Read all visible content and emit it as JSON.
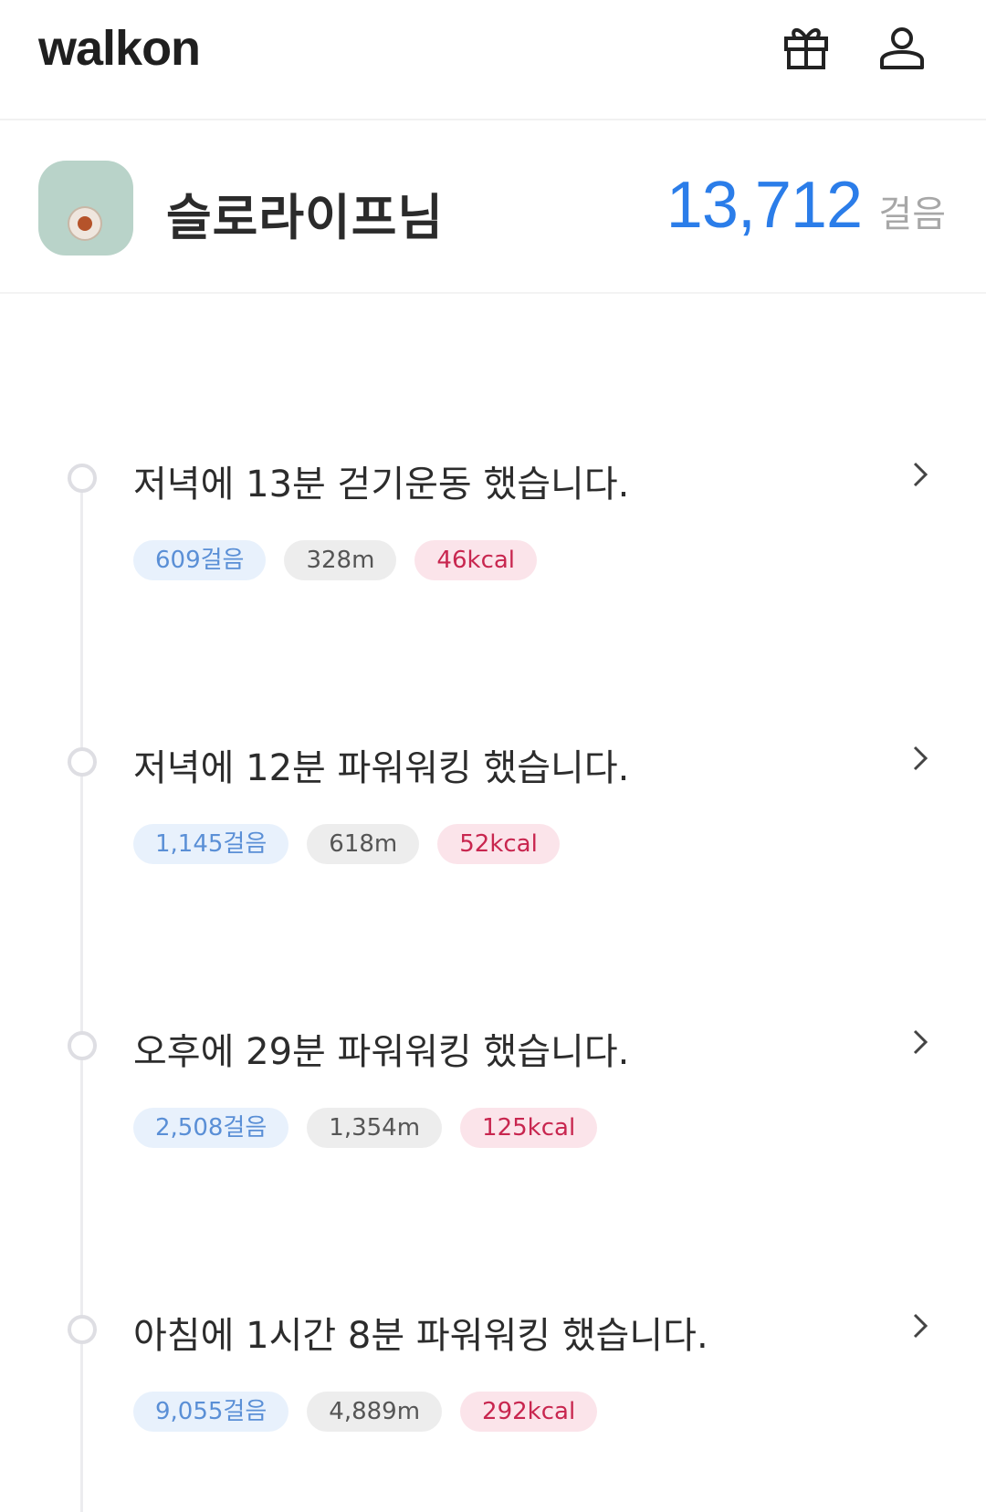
{
  "header": {
    "logo": "walkon",
    "icons": [
      "gift-icon",
      "person-icon"
    ]
  },
  "profile": {
    "name": "슬로라이프님",
    "steps": "13,712",
    "steps_unit": "걸음"
  },
  "entries": [
    {
      "title": "저녁에 13분 걷기운동 했습니다.",
      "steps": "609걸음",
      "distance": "328m",
      "kcal": "46kcal"
    },
    {
      "title": "저녁에 12분 파워워킹 했습니다.",
      "steps": "1,145걸음",
      "distance": "618m",
      "kcal": "52kcal"
    },
    {
      "title": "오후에 29분 파워워킹 했습니다.",
      "steps": "2,508걸음",
      "distance": "1,354m",
      "kcal": "125kcal"
    },
    {
      "title": "아침에 1시간 8분 파워워킹 했습니다.",
      "steps": "9,055걸음",
      "distance": "4,889m",
      "kcal": "292kcal"
    }
  ],
  "colors": {
    "accent": "#2b7de9",
    "steps_chip_bg": "#e8f1fc",
    "kcal_chip_bg": "#fbe4ea",
    "kcal_text": "#c8264f"
  }
}
